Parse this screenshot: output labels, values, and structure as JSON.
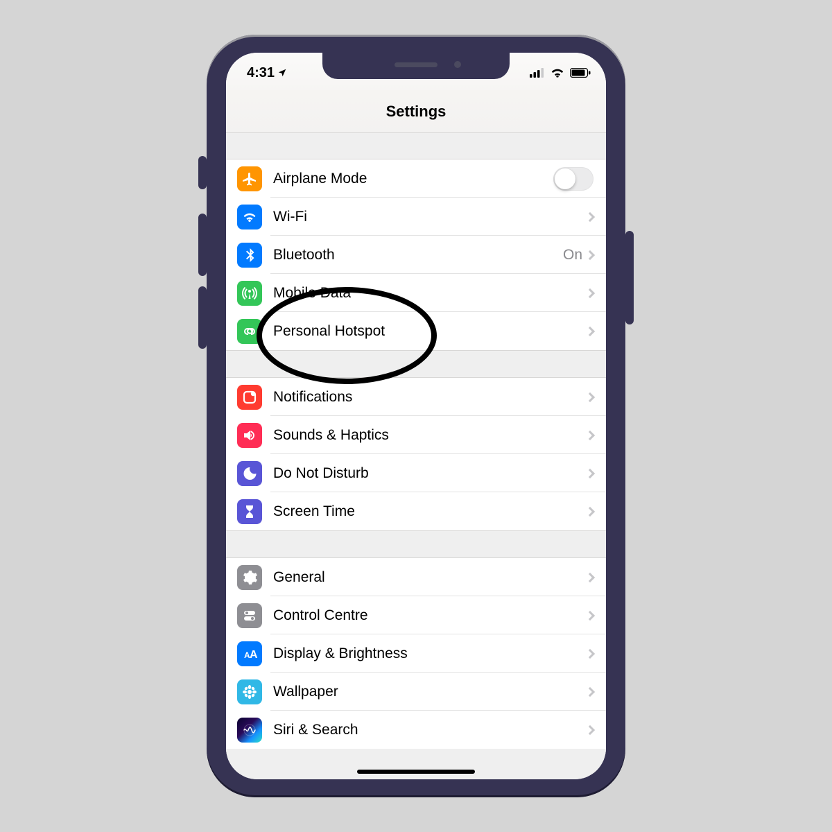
{
  "status": {
    "time": "4:31"
  },
  "header": {
    "title": "Settings"
  },
  "groups": [
    {
      "rows": [
        {
          "id": "airplane",
          "label": "Airplane Mode",
          "kind": "switch",
          "icon": "airplane-icon",
          "color": "ic-orange"
        },
        {
          "id": "wifi",
          "label": "Wi-Fi",
          "kind": "disclosure",
          "icon": "wifi-icon",
          "color": "ic-blue"
        },
        {
          "id": "bluetooth",
          "label": "Bluetooth",
          "kind": "disclosure",
          "detail": "On",
          "icon": "bluetooth-icon",
          "color": "ic-blue2"
        },
        {
          "id": "mobiledata",
          "label": "Mobile Data",
          "kind": "disclosure",
          "icon": "antenna-icon",
          "color": "ic-green"
        },
        {
          "id": "hotspot",
          "label": "Personal Hotspot",
          "kind": "disclosure",
          "icon": "hotspot-icon",
          "color": "ic-green2"
        }
      ]
    },
    {
      "rows": [
        {
          "id": "notifications",
          "label": "Notifications",
          "kind": "disclosure",
          "icon": "notifications-icon",
          "color": "ic-red"
        },
        {
          "id": "sounds",
          "label": "Sounds & Haptics",
          "kind": "disclosure",
          "icon": "speaker-icon",
          "color": "ic-pink"
        },
        {
          "id": "dnd",
          "label": "Do Not Disturb",
          "kind": "disclosure",
          "icon": "moon-icon",
          "color": "ic-purple"
        },
        {
          "id": "screentime",
          "label": "Screen Time",
          "kind": "disclosure",
          "icon": "hourglass-icon",
          "color": "ic-indigo"
        }
      ]
    },
    {
      "rows": [
        {
          "id": "general",
          "label": "General",
          "kind": "disclosure",
          "icon": "gear-icon",
          "color": "ic-gray"
        },
        {
          "id": "controlcentre",
          "label": "Control Centre",
          "kind": "disclosure",
          "icon": "switches-icon",
          "color": "ic-gray2"
        },
        {
          "id": "display",
          "label": "Display & Brightness",
          "kind": "disclosure",
          "icon": "textsize-icon",
          "color": "ic-bblue"
        },
        {
          "id": "wallpaper",
          "label": "Wallpaper",
          "kind": "disclosure",
          "icon": "flower-icon",
          "color": "ic-cyan"
        },
        {
          "id": "siri",
          "label": "Siri & Search",
          "kind": "disclosure",
          "icon": "siri-icon",
          "color": "ic-siri"
        }
      ]
    }
  ]
}
